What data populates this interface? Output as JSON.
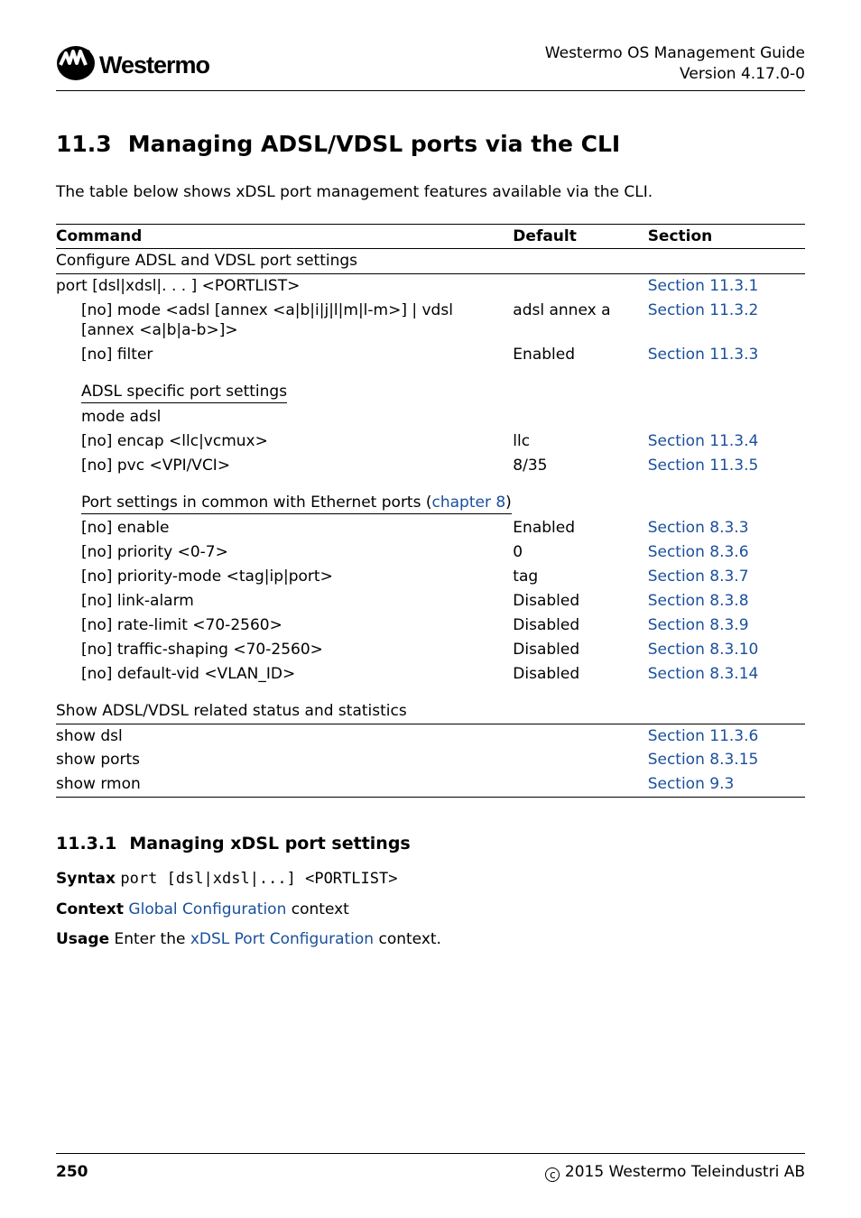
{
  "header": {
    "guide": "Westermo OS Management Guide",
    "version": "Version 4.17.0-0",
    "logo_brand": "Westermo"
  },
  "section": {
    "number": "11.3",
    "title": "Managing ADSL/VDSL ports via the CLI",
    "intro": "The table below shows xDSL port management features available via the CLI."
  },
  "table": {
    "head": {
      "c1": "Command",
      "c2": "Default",
      "c3": "Section"
    },
    "group1_label": "Configure ADSL and VDSL port settings",
    "rows1": [
      {
        "cmd": "port [dsl|xdsl|. . . ] <PORTLIST>",
        "def": "",
        "sec": "Section 11.3.1",
        "indent": 0
      },
      {
        "cmd": "[no] mode <adsl [annex <a|b|i|j|l|m|l-m>] | vdsl [annex <a|b|a-b>]>",
        "def": "adsl annex a",
        "sec": "Section 11.3.2",
        "indent": 1
      },
      {
        "cmd": "[no] filter",
        "def": "Enabled",
        "sec": "Section 11.3.3",
        "indent": 1
      }
    ],
    "group2_label": "ADSL specific port settings",
    "rows2": [
      {
        "cmd": "mode adsl",
        "def": "",
        "sec": "",
        "indent": 1
      },
      {
        "cmd": "[no] encap <llc|vcmux>",
        "def": "llc",
        "sec": "Section 11.3.4",
        "indent": 1
      },
      {
        "cmd": "[no] pvc <VPI/VCI>",
        "def": "8/35",
        "sec": "Section 11.3.5",
        "indent": 1
      }
    ],
    "group3_pre": "Port settings in common with Ethernet ports (",
    "group3_link": "chapter 8",
    "group3_post": ")",
    "rows3": [
      {
        "cmd": "[no] enable",
        "def": "Enabled",
        "sec": "Section 8.3.3",
        "indent": 1
      },
      {
        "cmd": "[no] priority <0-7>",
        "def": "0",
        "sec": "Section 8.3.6",
        "indent": 1
      },
      {
        "cmd": "[no] priority-mode <tag|ip|port>",
        "def": "tag",
        "sec": "Section 8.3.7",
        "indent": 1
      },
      {
        "cmd": "[no] link-alarm",
        "def": "Disabled",
        "sec": "Section 8.3.8",
        "indent": 1
      },
      {
        "cmd": "[no] rate-limit <70-2560>",
        "def": "Disabled",
        "sec": "Section 8.3.9",
        "indent": 1
      },
      {
        "cmd": "[no] traffic-shaping <70-2560>",
        "def": "Disabled",
        "sec": "Section 8.3.10",
        "indent": 1
      },
      {
        "cmd": "[no] default-vid <VLAN_ID>",
        "def": "Disabled",
        "sec": "Section 8.3.14",
        "indent": 1
      }
    ],
    "group4_label": "Show ADSL/VDSL related status and statistics",
    "rows4": [
      {
        "cmd": "show dsl",
        "def": "",
        "sec": "Section 11.3.6",
        "indent": 0
      },
      {
        "cmd": "show ports",
        "def": "",
        "sec": "Section 8.3.15",
        "indent": 0
      },
      {
        "cmd": "show rmon",
        "def": "",
        "sec": "Section 9.3",
        "indent": 0
      }
    ]
  },
  "subsection": {
    "number": "11.3.1",
    "title": "Managing xDSL port settings",
    "syntax_label": "Syntax",
    "syntax_value": "port [dsl|xdsl|...] <PORTLIST>",
    "context_label": "Context",
    "context_link": "Global Configuration",
    "context_post": " context",
    "usage_label": "Usage",
    "usage_pre": "Enter the ",
    "usage_link": "xDSL Port Configuration",
    "usage_post": " context."
  },
  "footer": {
    "page": "250",
    "copy_text": " 2015 Westermo Teleindustri AB"
  }
}
